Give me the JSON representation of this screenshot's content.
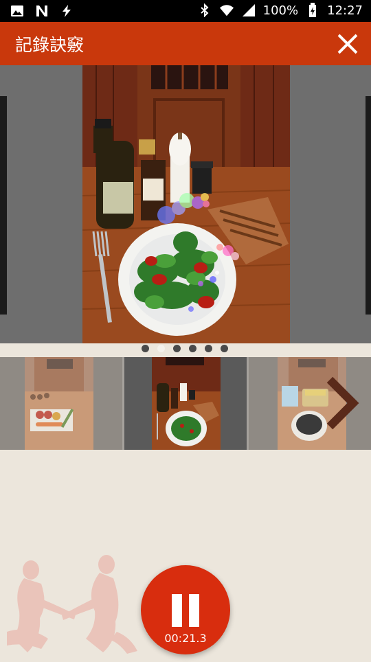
{
  "status_bar": {
    "battery": "100%",
    "time": "12:27",
    "left_icons": [
      "image-icon",
      "n-logo-icon",
      "flash-icon"
    ],
    "right_icons": [
      "bluetooth-icon",
      "wifi-icon",
      "signal-icon",
      "battery-icon"
    ]
  },
  "header": {
    "title": "記錄訣竅",
    "close_icon": "close-icon",
    "color": "#c9380c"
  },
  "viewer": {
    "page_count": 6,
    "current_page": 2
  },
  "thumbnails": [
    {
      "name": "thumb-1-vegetables"
    },
    {
      "name": "thumb-2-salad",
      "selected": true
    },
    {
      "name": "thumb-3-beans"
    }
  ],
  "recorder": {
    "timer": "00:21.3",
    "state_icon": "pause-icon",
    "color": "#d82d0e"
  }
}
